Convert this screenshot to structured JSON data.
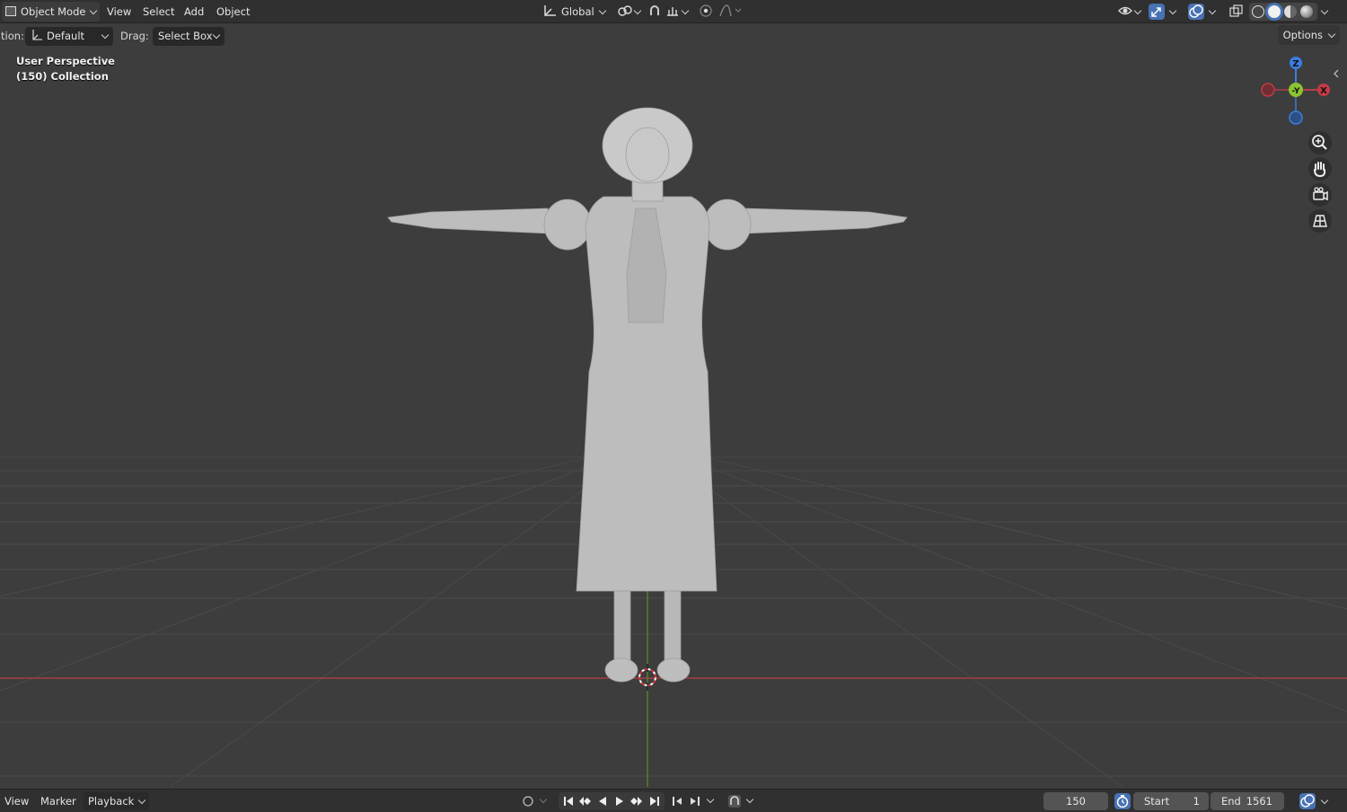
{
  "header": {
    "mode_label": "Object Mode",
    "menu": [
      "View",
      "Select",
      "Add",
      "Object"
    ],
    "transform_orientation": "Global",
    "icons": [
      "object-mode-icon",
      "orientation-icon",
      "pivot-icon",
      "snap-icon",
      "snap-increment-icon",
      "proportional-edit-icon",
      "falloff-icon",
      "visibility-icon",
      "gizmo-icon",
      "overlay-icon",
      "xray-icon",
      "wireframe-shading-icon",
      "solid-shading-icon",
      "material-shading-icon",
      "rendered-shading-icon"
    ]
  },
  "toolbar": {
    "orientation_label": "tion:",
    "orientation_value": "Default",
    "drag_label": "Drag:",
    "drag_value": "Select Box",
    "options_label": "Options"
  },
  "viewport": {
    "perspective_label": "User Perspective",
    "collection_label": "(150) Collection",
    "gizmo_axes": {
      "z": "Z",
      "y": "-Y",
      "x": "X"
    },
    "colors": {
      "background": "#3d3d3d",
      "x_axis": "#b83e48",
      "y_axis": "#6aa531",
      "z_axis": "#3b7ee0"
    },
    "nav_icons": [
      "zoom-icon",
      "pan-hand-icon",
      "camera-icon",
      "grid-view-icon"
    ]
  },
  "timeline": {
    "menu": [
      "View",
      "Marker",
      "Playback"
    ],
    "current_frame": "150",
    "start_label": "Start",
    "start_value": "1",
    "end_label": "End",
    "end_value": "1561",
    "icons": [
      "record-icon",
      "jump-start-icon",
      "prev-keyframe-icon",
      "play-reverse-icon",
      "play-icon",
      "next-keyframe-icon",
      "jump-end-icon",
      "keying-icon",
      "autokey-icon",
      "clock-icon",
      "sync-icon"
    ]
  }
}
